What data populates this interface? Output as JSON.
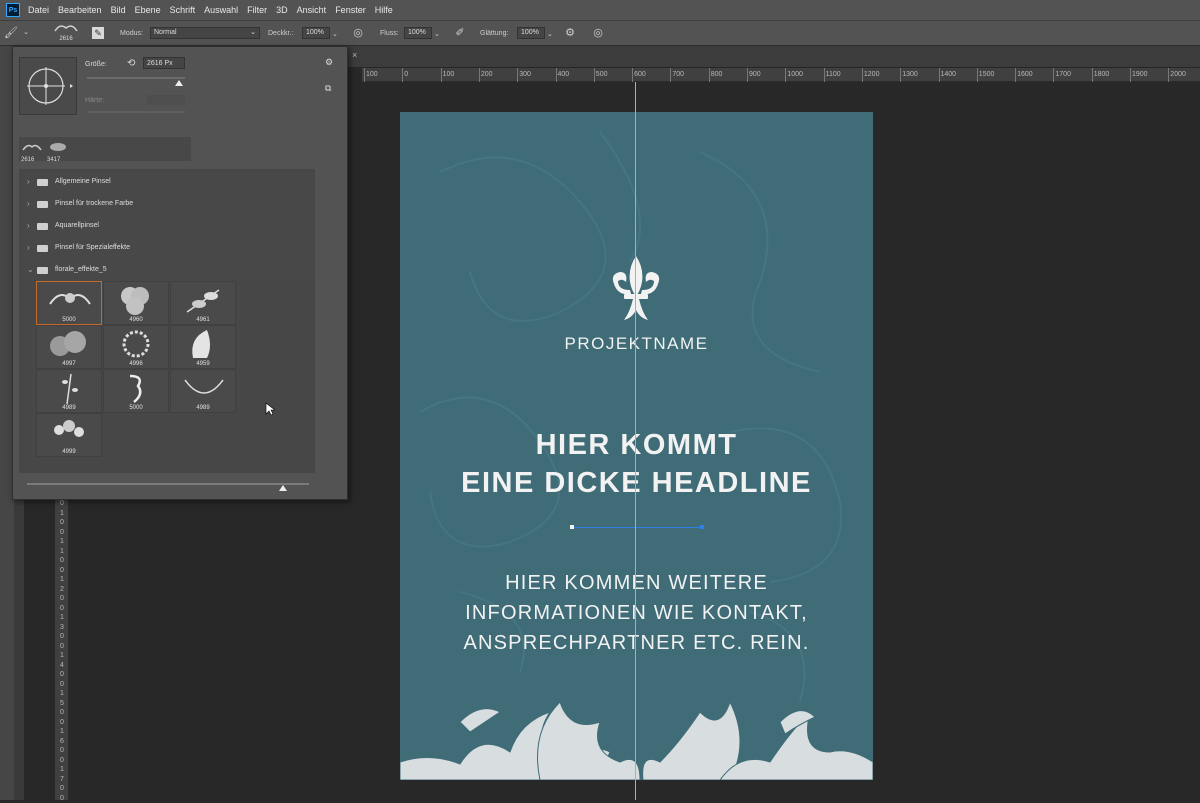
{
  "app": {
    "logo": "Ps"
  },
  "menu": [
    "Datei",
    "Bearbeiten",
    "Bild",
    "Ebene",
    "Schrift",
    "Auswahl",
    "Filter",
    "3D",
    "Ansicht",
    "Fenster",
    "Hilfe"
  ],
  "options": {
    "brush_size_preview": "2616",
    "modus_label": "Modus:",
    "modus_value": "Normal",
    "deckkraft_label": "Deckkr.:",
    "deckkraft_value": "100%",
    "fluss_label": "Fluss:",
    "fluss_value": "100%",
    "glaettung_label": "Glättung:",
    "glaettung_value": "100%"
  },
  "brush_panel": {
    "groesse_label": "Größe:",
    "groesse_value": "2616 Px",
    "haerte_label": "Härte:",
    "recent": [
      "2616",
      "3417"
    ],
    "folders": [
      "Allgemeine Pinsel",
      "Pinsel für trockene Farbe",
      "Aquarellpinsel",
      "Pinsel für Spezialeffekte",
      "florale_effekte_5"
    ],
    "thumbs": [
      "5000",
      "4960",
      "4961",
      "4997",
      "4996",
      "4959",
      "4989",
      "5000",
      "4989",
      "4999"
    ]
  },
  "ruler_h": [
    "100",
    "0",
    "100",
    "200",
    "300",
    "400",
    "500",
    "600",
    "700",
    "800",
    "900",
    "1000",
    "1100",
    "1200",
    "1300",
    "1400",
    "1500",
    "1600",
    "1700",
    "1800",
    "1900",
    "2000"
  ],
  "ruler_v": [
    "0",
    "1",
    "0",
    "0",
    "1",
    "1",
    "0",
    "0",
    "1",
    "2",
    "0",
    "0",
    "1",
    "3",
    "0",
    "0",
    "1",
    "4",
    "0",
    "0",
    "1",
    "5",
    "0",
    "0",
    "1",
    "6",
    "0",
    "0",
    "1",
    "7",
    "0",
    "0"
  ],
  "poster": {
    "project": "PROJEKTNAME",
    "headline_1": "HIER KOMMT",
    "headline_2": "EINE DICKE HEADLINE",
    "info_1": "HIER KOMMEN WEITERE",
    "info_2": "INFORMATIONEN WIE KONTAKT,",
    "info_3": "ANSPRECHPARTNER ETC. REIN.",
    "bg_color": "#3f6c77",
    "text_color": "#f2f2f2"
  },
  "colors": {
    "guide": "#33e0ef",
    "selection": "#c46a2a",
    "path": "#2f7fe6"
  }
}
